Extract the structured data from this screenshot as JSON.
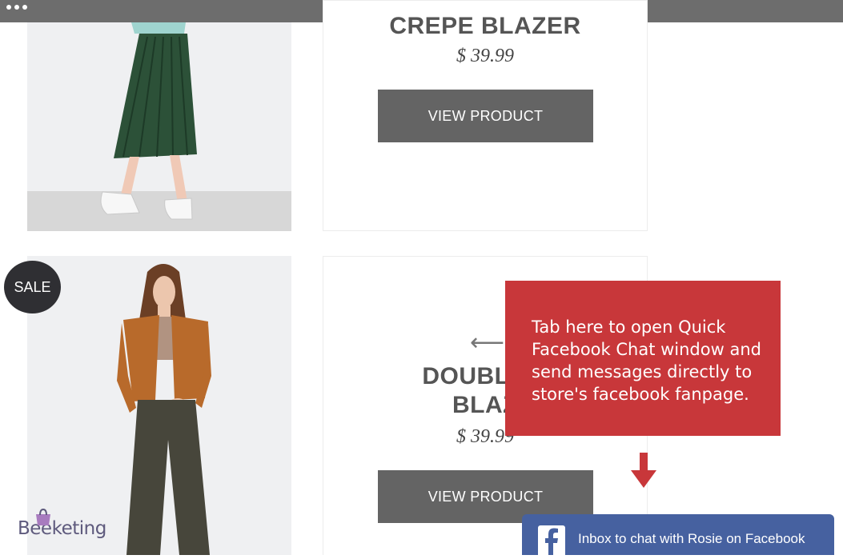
{
  "product_1": {
    "title": "CREPE BLAZER",
    "price": "$ 39.99",
    "button_label": "VIEW PRODUCT"
  },
  "product_2": {
    "badge": "SALE",
    "title_line1": "DOUBLE F",
    "title_line2": "BLAZ",
    "price": "$ 39.99",
    "button_label": "VIEW PRODUCT"
  },
  "tooltip": {
    "text": "Tab here to open Quick Facebook Chat window and send messages directly to store's facebook fanpage."
  },
  "messenger_bar": {
    "label": "Inbox to chat with Rosie on Facebook",
    "icon": "facebook-icon"
  },
  "brand": {
    "logo_text": "Beeketing"
  },
  "colors": {
    "tooltip_bg": "#c8373a",
    "facebook_blue": "#4661a0",
    "button_bg": "#646464",
    "topbar": "#6d6d6d"
  }
}
